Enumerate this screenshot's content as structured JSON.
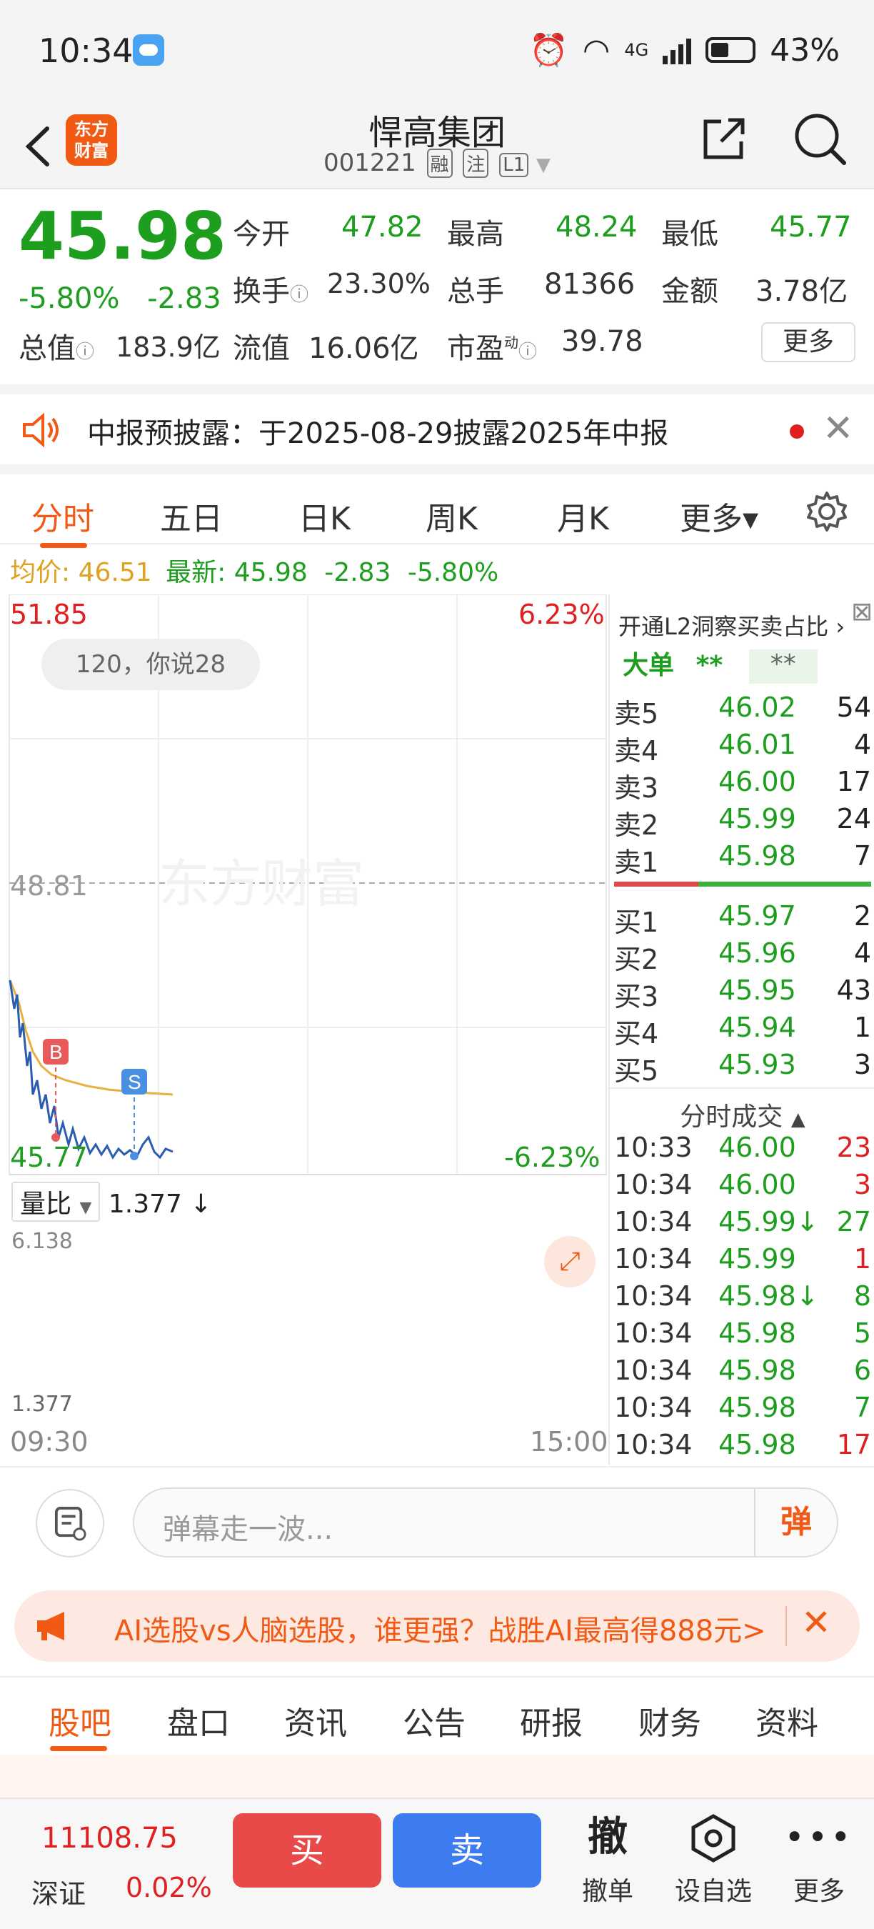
{
  "status": {
    "time": "10:34",
    "network": "4G",
    "battery": "43%"
  },
  "header": {
    "back_icon": "chevron-left-icon",
    "logo_text": [
      "东方",
      "财富"
    ],
    "stock_name": "悍高集团",
    "stock_code": "001221",
    "tags": [
      "融",
      "注",
      "L1"
    ]
  },
  "quote": {
    "price": "45.98",
    "change_pct": "-5.80%",
    "change": "-2.83",
    "open_label": "今开",
    "open": "47.82",
    "high_label": "最高",
    "high": "48.24",
    "low_label": "最低",
    "low": "45.77",
    "turnover_label": "换手",
    "turnover": "23.30%",
    "volume_label": "总手",
    "volume": "81366",
    "amount_label": "金额",
    "amount": "3.78亿",
    "mktcap_label": "总值",
    "mktcap": "183.9亿",
    "float_label": "流值",
    "float": "16.06亿",
    "pe_label": "市盈",
    "pe_sup": "动",
    "pe": "39.78",
    "more": "更多"
  },
  "notice": {
    "text": "中报预披露：于2025-08-29披露2025年中报"
  },
  "tabs": [
    "分时",
    "五日",
    "日K",
    "周K",
    "月K",
    "更多▾"
  ],
  "avg": {
    "avg_label": "均价:",
    "avg": "46.51",
    "latest_label": "最新:",
    "latest": "45.98",
    "chg": "-2.83",
    "pct": "-5.80%"
  },
  "chart": {
    "y_top": "51.85",
    "y_top_pct": "6.23%",
    "y_mid": "48.81",
    "y_bot": "45.77",
    "y_bot_pct": "-6.23%",
    "danmaku": "120，你说28",
    "watermark": "东方财富",
    "marker_b": "B",
    "marker_s": "S",
    "vol_label": "量比",
    "vol_value": "1.377",
    "vol_top": "6.138",
    "vol_bottom": "1.377",
    "time_start": "09:30",
    "time_end": "15:00"
  },
  "orderbook": {
    "header": "开通L2洞察买卖占比",
    "big_label": "大单",
    "big_stars": "**",
    "big_stars2": "**",
    "asks": [
      {
        "label": "卖5",
        "price": "46.02",
        "qty": "54"
      },
      {
        "label": "卖4",
        "price": "46.01",
        "qty": "4"
      },
      {
        "label": "卖3",
        "price": "46.00",
        "qty": "17"
      },
      {
        "label": "卖2",
        "price": "45.99",
        "qty": "24"
      },
      {
        "label": "卖1",
        "price": "45.98",
        "qty": "7"
      }
    ],
    "bids": [
      {
        "label": "买1",
        "price": "45.97",
        "qty": "2"
      },
      {
        "label": "买2",
        "price": "45.96",
        "qty": "4"
      },
      {
        "label": "买3",
        "price": "45.95",
        "qty": "43"
      },
      {
        "label": "买4",
        "price": "45.94",
        "qty": "1"
      },
      {
        "label": "买5",
        "price": "45.93",
        "qty": "3"
      }
    ],
    "trades_title": "分时成交",
    "trades": [
      {
        "time": "10:33",
        "price": "46.00",
        "qty": "23",
        "dir": "up"
      },
      {
        "time": "10:34",
        "price": "46.00",
        "qty": "3",
        "dir": "up"
      },
      {
        "time": "10:34",
        "price": "45.99↓",
        "qty": "27",
        "dir": "down"
      },
      {
        "time": "10:34",
        "price": "45.99",
        "qty": "1",
        "dir": "up"
      },
      {
        "time": "10:34",
        "price": "45.98↓",
        "qty": "8",
        "dir": "down"
      },
      {
        "time": "10:34",
        "price": "45.98",
        "qty": "5",
        "dir": "down"
      },
      {
        "time": "10:34",
        "price": "45.98",
        "qty": "6",
        "dir": "down"
      },
      {
        "time": "10:34",
        "price": "45.98",
        "qty": "7",
        "dir": "down"
      },
      {
        "time": "10:34",
        "price": "45.98",
        "qty": "17",
        "dir": "up"
      }
    ]
  },
  "comment": {
    "placeholder": "弹幕走一波...",
    "dan_label": "弹"
  },
  "ad": {
    "text": "AI选股vs人脑选股，谁更强？战胜AI最高得888元>"
  },
  "bottom_tabs": [
    "股吧",
    "盘口",
    "资讯",
    "公告",
    "研报",
    "财务",
    "资料"
  ],
  "action": {
    "index_value": "11108.75",
    "index_name": "深证",
    "index_pct": "0.02%",
    "buy": "买",
    "sell": "卖",
    "cancel_icon": "撤",
    "cancel": "撤单",
    "watch": "设自选",
    "more": "更多"
  },
  "colors": {
    "up": "#e02020",
    "down": "#1e9e1e",
    "brand": "#f05a14",
    "buy": "#e84a4a",
    "sell": "#3d7cf0"
  }
}
